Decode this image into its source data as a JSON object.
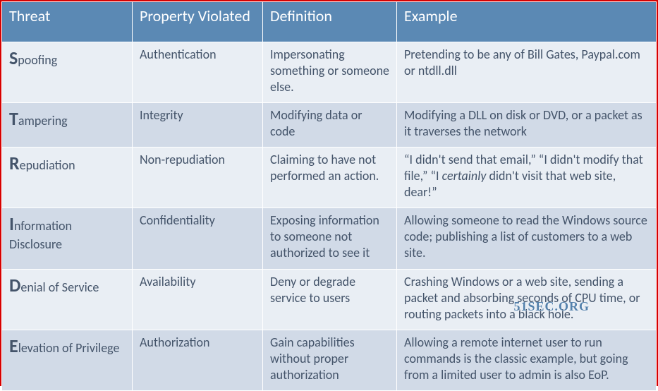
{
  "headers": {
    "threat": "Threat",
    "property": "Property Violated",
    "definition": " Definition",
    "example": "Example"
  },
  "rows": [
    {
      "threat_initial": "S",
      "threat_rest": "poofing",
      "property": "Authentication",
      "definition": "Impersonating something or someone else.",
      "example": "Pretending to be any of Bill Gates, Paypal.com or ntdll.dll"
    },
    {
      "threat_initial": "T",
      "threat_rest": "ampering",
      "property": "Integrity",
      "definition": "Modifying data or code",
      "example": "Modifying a DLL on disk or DVD, or a packet as it traverses the network"
    },
    {
      "threat_initial": "R",
      "threat_rest": "epudiation",
      "property": "Non-repudiation",
      "definition": "Claiming to have not performed an action.",
      "example_parts": [
        "“I didn't send that email,” “I didn't modify that file,” “I ",
        "certainly",
        " didn't visit that web site, dear!”"
      ]
    },
    {
      "threat_initial": "I",
      "threat_rest": "nformation Disclosure",
      "property": "Confidentiality",
      "definition": "Exposing information to someone not authorized to see it",
      "example": "Allowing someone to read the Windows source code; publishing a list of customers to a web site."
    },
    {
      "threat_initial": "D",
      "threat_rest": "enial of Service",
      "property": "Availability",
      "definition": "Deny or degrade service to users",
      "example": "Crashing Windows or a web site, sending a packet and absorbing seconds of CPU time, or routing packets into a black hole."
    },
    {
      "threat_initial": "E",
      "threat_rest": "levation of Privilege",
      "property": "Authorization",
      "definition": "Gain capabilities without proper authorization",
      "example": "Allowing a remote internet user to run commands is the classic example, but going from a limited user to admin is also EoP."
    }
  ],
  "watermark": "51SEC.ORG"
}
